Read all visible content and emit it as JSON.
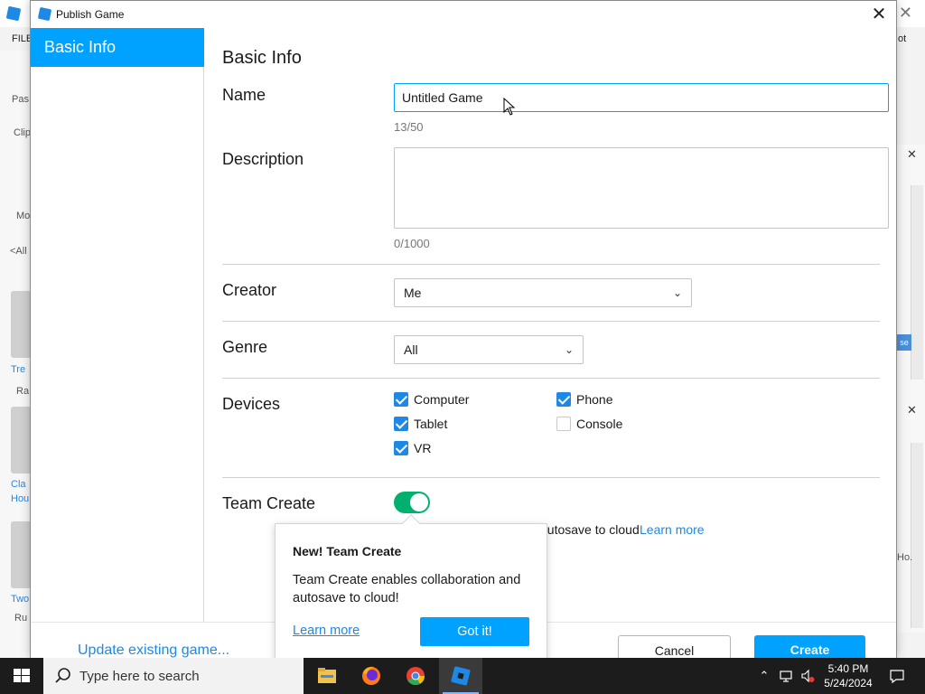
{
  "background": {
    "menu_file": "FILE",
    "menu_right": "ot",
    "left_texts": [
      "Pas",
      "Clip",
      "Mo",
      "<All",
      "Tre",
      "Ra",
      "Cla",
      "Hou",
      "Two",
      "Ru"
    ],
    "right_texts": [
      "se",
      "Ho."
    ]
  },
  "dialog": {
    "title": "Publish Game",
    "close_glyph": "✕"
  },
  "sidebar": {
    "items": [
      {
        "label": "Basic Info"
      }
    ]
  },
  "form": {
    "section_title": "Basic Info",
    "name": {
      "label": "Name",
      "value": "Untitled Game",
      "counter": "13/50"
    },
    "description": {
      "label": "Description",
      "value": "",
      "counter": "0/1000"
    },
    "creator": {
      "label": "Creator",
      "selected": "Me"
    },
    "genre": {
      "label": "Genre",
      "selected": "All"
    },
    "devices": {
      "label": "Devices",
      "options": [
        {
          "label": "Computer",
          "checked": true
        },
        {
          "label": "Phone",
          "checked": true
        },
        {
          "label": "Tablet",
          "checked": true
        },
        {
          "label": "Console",
          "checked": false
        },
        {
          "label": "VR",
          "checked": true
        }
      ]
    },
    "team_create": {
      "label": "Team Create",
      "enabled": true,
      "description": "autosave to cloud",
      "learn_more": "Learn more"
    }
  },
  "popover": {
    "title": "New! Team Create",
    "body": "Team Create enables collaboration and autosave to cloud!",
    "learn_more": "Learn more",
    "button": "Got it!"
  },
  "footer": {
    "update_link": "Update existing game...",
    "cancel": "Cancel",
    "create": "Create"
  },
  "taskbar": {
    "search_placeholder": "Type here to search",
    "time": "5:40 PM",
    "date": "5/24/2024"
  },
  "colors": {
    "accent": "#00a2ff",
    "toggle_on": "#00b06f",
    "link": "#1e88e5"
  }
}
